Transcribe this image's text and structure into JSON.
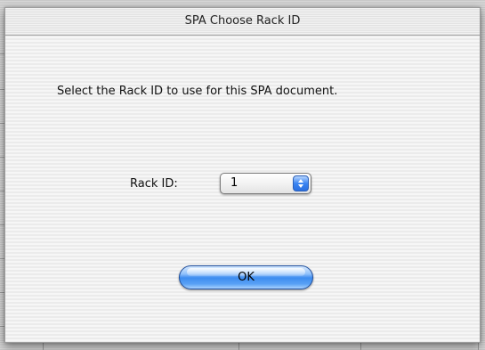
{
  "window": {
    "title": "SPA Choose Rack ID"
  },
  "dialog": {
    "message": "Select the Rack ID to use for this SPA document.",
    "rack_label": "Rack ID:",
    "rack_select": {
      "selected": "1"
    },
    "ok_label": "OK"
  },
  "colors": {
    "button_accent": "#3d8cf0",
    "popup_arrow_accent": "#3a84f2"
  },
  "icons": {
    "popup_arrows": "up-down-chevron-icon"
  }
}
